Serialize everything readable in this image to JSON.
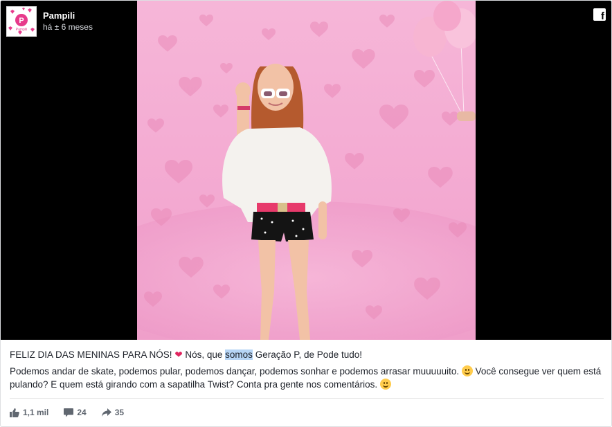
{
  "page": {
    "name": "Pampili",
    "timestamp": "há ± 6 meses",
    "avatar_text": "Pampili"
  },
  "caption": {
    "line1_before": "FELIZ DIA DAS MENINAS PARA NÓS! ",
    "line1_emoji": "❤",
    "line1_mid": " Nós, que ",
    "line1_highlight": "somos",
    "line1_after": " Geração P, de Pode tudo!",
    "line2_before": "Podemos andar de skate, podemos pular, podemos dançar, podemos sonhar e podemos arrasar muuuuuito. ",
    "line2_mid": " Você consegue ver quem está pulando? E quem está girando com a sapatilha Twist? Conta pra gente nos comentários. ",
    "line2_after": ""
  },
  "stats": {
    "likes": "1,1 mil",
    "comments": "24",
    "shares": "35"
  },
  "colors": {
    "photo_background": "#f2a7cf",
    "heart_pink": "#e985b8",
    "blouse": "#f4f2ee",
    "belt": "#e73a6b",
    "shorts": "#141414"
  },
  "icons": [
    "facebook-icon",
    "like-icon",
    "comment-icon",
    "share-icon"
  ]
}
